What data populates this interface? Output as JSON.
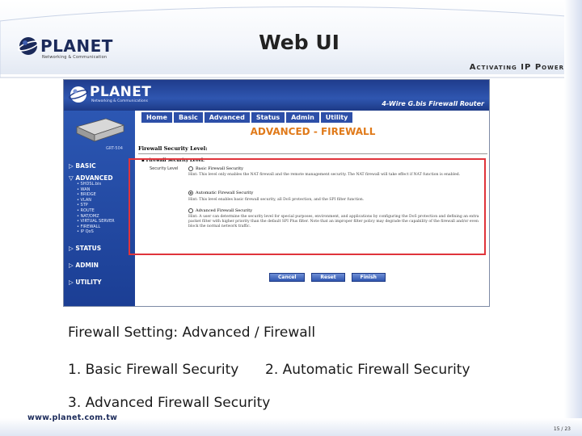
{
  "slide": {
    "title": "Web UI",
    "tagline": "Activating IP Power",
    "logo_word": "PLANET",
    "logo_sub": "Networking & Communication",
    "caption_1": "Firewall Setting: Advanced / Firewall",
    "caption_2a": "1. Basic Firewall Security",
    "caption_2b": "2. Automatic Firewall Security",
    "caption_3": "3. Advanced Firewall Security",
    "url": "www.planet.com.tw",
    "page": "15 / 23",
    "colors": {
      "highlight": "#e0343b",
      "router_blue": "#2c57b3",
      "section_orange": "#e07a1a"
    }
  },
  "router": {
    "logo_word": "PLANET",
    "logo_sub": "Networking & Communications",
    "product": "4-Wire G.bis Firewall Router",
    "device_label": "GRT-504",
    "tabs": [
      "Home",
      "Basic",
      "Advanced",
      "Status",
      "Admin",
      "Utility"
    ],
    "section_title": "ADVANCED - FIREWALL",
    "subtitle": "Firewall Security Level:",
    "fw_label": "Firewall Security Level:",
    "level_label": "Security Level",
    "menu": {
      "basic": "BASIC",
      "advanced": "ADVANCED",
      "advanced_items": [
        "SHDSL.bis",
        "WAN",
        "BRIDGE",
        "VLAN",
        "STP",
        "ROUTE",
        "NAT/DMZ",
        "VIRTUAL SERVER",
        "FIREWALL",
        "IP QoS"
      ],
      "status": "STATUS",
      "admin": "ADMIN",
      "utility": "UTILITY"
    },
    "options": [
      {
        "label": "Basic Firewall Security",
        "selected": false
      },
      {
        "label": "Automatic Firewall Security",
        "selected": true
      },
      {
        "label": "Advanced Firewall Security",
        "selected": false
      }
    ],
    "hints": [
      "Hint: This level only enables the NAT firewall and the remote management security. The NAT firewall will take effect if NAT function is enabled.",
      "Hint: This level enables basic firewall security, all DoS protection, and the SPI filter function.",
      "Hint: A user can determine the security level for special purposes, environment, and applications by configuring the DoS protection and defining an extra packet filter with higher priority than the default SPI Plus filter. Note that an improper filter policy may degrade the capability of the firewall and/or even block the normal network traffic."
    ],
    "buttons": [
      "Cancel",
      "Reset",
      "Finish"
    ]
  }
}
